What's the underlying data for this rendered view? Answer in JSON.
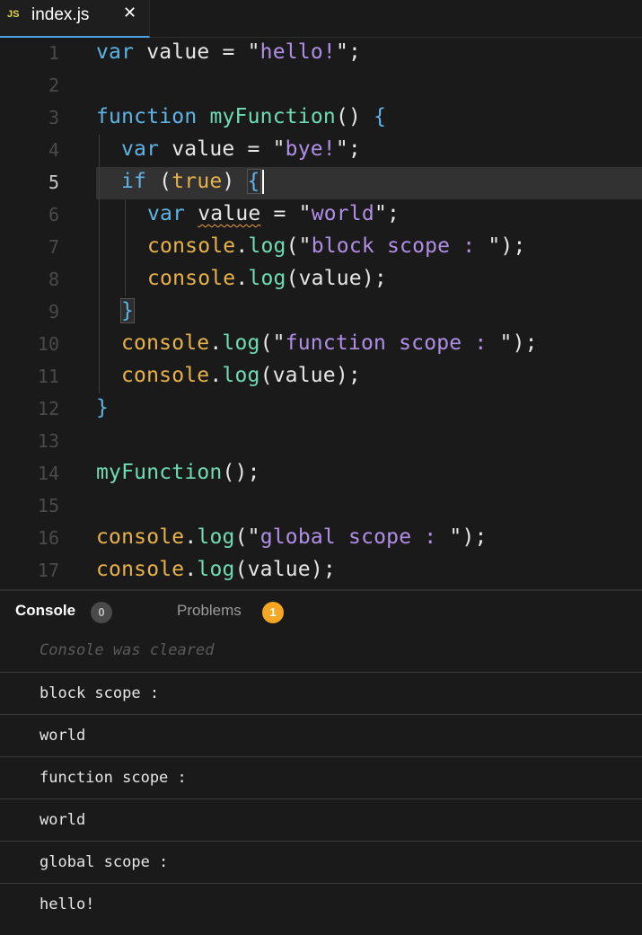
{
  "tab": {
    "icon": "JS",
    "title": "index.js",
    "close": "✕"
  },
  "editor": {
    "line_numbers": [
      "1",
      "2",
      "3",
      "4",
      "5",
      "6",
      "7",
      "8",
      "9",
      "10",
      "11",
      "12",
      "13",
      "14",
      "15",
      "16",
      "17"
    ],
    "active_line": "5",
    "lines": {
      "l1": {
        "kw": "var",
        "rest": " value = ",
        "q1": "\"",
        "str": "hello!",
        "q2": "\"",
        "end": ";"
      },
      "l3": {
        "kw": "function",
        "sp": " ",
        "fn": "myFunction",
        "paren": "() ",
        "brace": "{"
      },
      "l4": {
        "kw": "var",
        "rest": " value = ",
        "q1": "\"",
        "str": "bye!",
        "q2": "\"",
        "end": ";"
      },
      "l5": {
        "kw": "if",
        "sp": " (",
        "bool": "true",
        "close": ") ",
        "brace": "{"
      },
      "l6": {
        "kw": "var",
        "sp": " ",
        "ident": "value",
        "rest": " = ",
        "q1": "\"",
        "str": "world",
        "q2": "\"",
        "end": ";"
      },
      "l7": {
        "obj": "console",
        "dot": ".",
        "fn": "log",
        "open": "(",
        "q1": "\"",
        "str": "block scope : ",
        "q2": "\"",
        "end": ");"
      },
      "l8": {
        "obj": "console",
        "dot": ".",
        "fn": "log",
        "rest": "(value);"
      },
      "l9": {
        "brace": "}"
      },
      "l10": {
        "obj": "console",
        "dot": ".",
        "fn": "log",
        "open": "(",
        "q1": "\"",
        "str": "function scope : ",
        "q2": "\"",
        "end": ");"
      },
      "l11": {
        "obj": "console",
        "dot": ".",
        "fn": "log",
        "rest": "(value);"
      },
      "l12": {
        "brace": "}"
      },
      "l14": {
        "fn": "myFunction",
        "rest": "();"
      },
      "l16": {
        "obj": "console",
        "dot": ".",
        "fn": "log",
        "open": "(",
        "q1": "\"",
        "str": "global scope : ",
        "q2": "\"",
        "end": ");"
      },
      "l17": {
        "obj": "console",
        "dot": ".",
        "fn": "log",
        "rest": "(value);"
      }
    }
  },
  "panel": {
    "tabs": {
      "console": {
        "label": "Console",
        "badge": "0"
      },
      "problems": {
        "label": "Problems",
        "badge": "1"
      }
    },
    "cleared_message": "Console was cleared",
    "logs": [
      "block scope :",
      "world",
      "function scope :",
      "world",
      "global scope :",
      "hello!"
    ]
  },
  "colors": {
    "keyword": "#5fb4e6",
    "string": "#b18ee6",
    "function": "#6fdcb4",
    "object": "#e8b24a",
    "accent": "#4ba3e3",
    "problems_badge": "#f5a623"
  }
}
